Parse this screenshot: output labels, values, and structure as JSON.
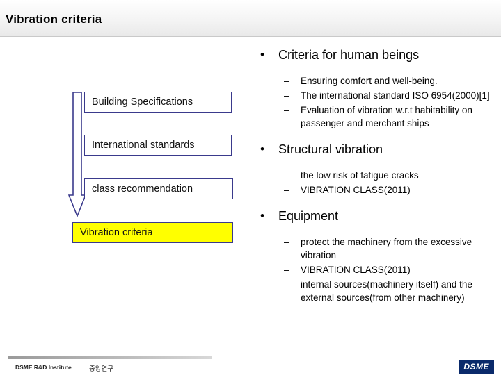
{
  "slide": {
    "title": "Vibration criteria"
  },
  "flow_boxes": [
    {
      "label": "Building Specifications",
      "highlight": false
    },
    {
      "label": "International standards",
      "highlight": false
    },
    {
      "label": "class recommendation",
      "highlight": false
    },
    {
      "label": "Vibration criteria",
      "highlight": true
    }
  ],
  "arrow": {
    "name": "down-arrow",
    "color": "#3a3a8c"
  },
  "content": {
    "bullet_l1_marker": "•",
    "bullet_l2_marker": "–",
    "sections": [
      {
        "heading": "Criteria for human beings",
        "items": [
          "Ensuring comfort and well-being.",
          "The international standard ISO 6954(2000)[1]",
          "Evaluation of vibration w.r.t habitability on passenger and merchant ships"
        ]
      },
      {
        "heading": "Structural vibration",
        "items": [
          "the low risk of fatigue cracks",
          "VIBRATION CLASS(2011)"
        ]
      },
      {
        "heading": "Equipment",
        "items": [
          "protect the machinery from the excessive vibration",
          "VIBRATION CLASS(2011)",
          "internal sources(machinery itself) and the external sources(from other machinery)"
        ]
      }
    ]
  },
  "footer": {
    "left_text": "DSME R&D Institute",
    "korean_text": "중앙연구",
    "logo_text": "DSME"
  },
  "colors": {
    "highlight": "#ffff00",
    "box_border": "#3a3a8c",
    "logo_bg": "#0a2a6b"
  }
}
